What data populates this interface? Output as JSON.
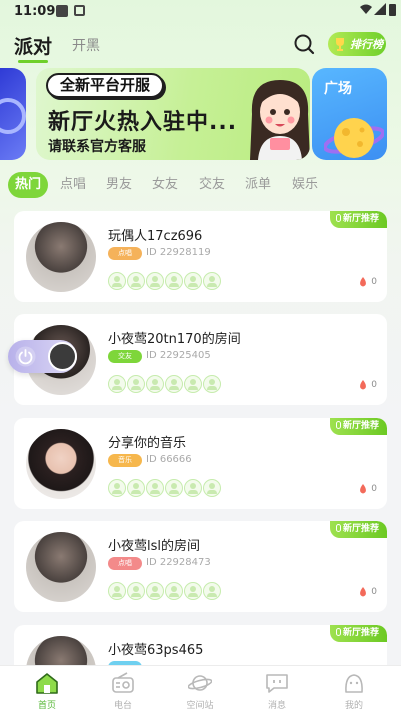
{
  "status_bar": {
    "time": "11:09"
  },
  "top_nav": {
    "title": "派对",
    "subtitle": "开黑",
    "rank_label": "排行榜"
  },
  "banner": {
    "pill_text": "全新平台开服",
    "headline": "新厅火热入驻中...",
    "subline": "请联系官方客服",
    "side_title": "广场"
  },
  "tabs": [
    "热门",
    "点唱",
    "男友",
    "女友",
    "交友",
    "派单",
    "娱乐"
  ],
  "active_tab_index": 0,
  "rooms": [
    {
      "name": "玩偶人17cz696",
      "tag": "点唱",
      "tag_color": "#f5b25a",
      "id": "ID 22928119",
      "heat": "0",
      "badge": "新厅推荐"
    },
    {
      "name": "小夜莺20tn170的房间",
      "tag": "交友",
      "tag_color": "#7ed63a",
      "id": "ID 22925405",
      "heat": "0",
      "badge": ""
    },
    {
      "name": "分享你的音乐",
      "tag": "音乐",
      "tag_color": "#f6b74d",
      "id": "ID 66666",
      "heat": "0",
      "badge": "新厅推荐"
    },
    {
      "name": "小夜莺lsl的房间",
      "tag": "点唱",
      "tag_color": "#f38a8a",
      "id": "ID 22928473",
      "heat": "0",
      "badge": "新厅推荐"
    },
    {
      "name": "小夜莺63ps465",
      "tag": "",
      "tag_color": "#6fd0f0",
      "id": "",
      "heat": "",
      "badge": "新厅推荐"
    }
  ],
  "bottom_nav": [
    {
      "label": "首页",
      "icon": "home-icon",
      "active": true
    },
    {
      "label": "电台",
      "icon": "radio-icon",
      "active": false
    },
    {
      "label": "空间站",
      "icon": "planet-icon",
      "active": false
    },
    {
      "label": "消息",
      "icon": "message-icon",
      "active": false
    },
    {
      "label": "我的",
      "icon": "profile-icon",
      "active": false
    }
  ],
  "colors": {
    "accent": "#7ed63a",
    "badge_green": "#6cc923",
    "flame": "#f36a5a"
  }
}
